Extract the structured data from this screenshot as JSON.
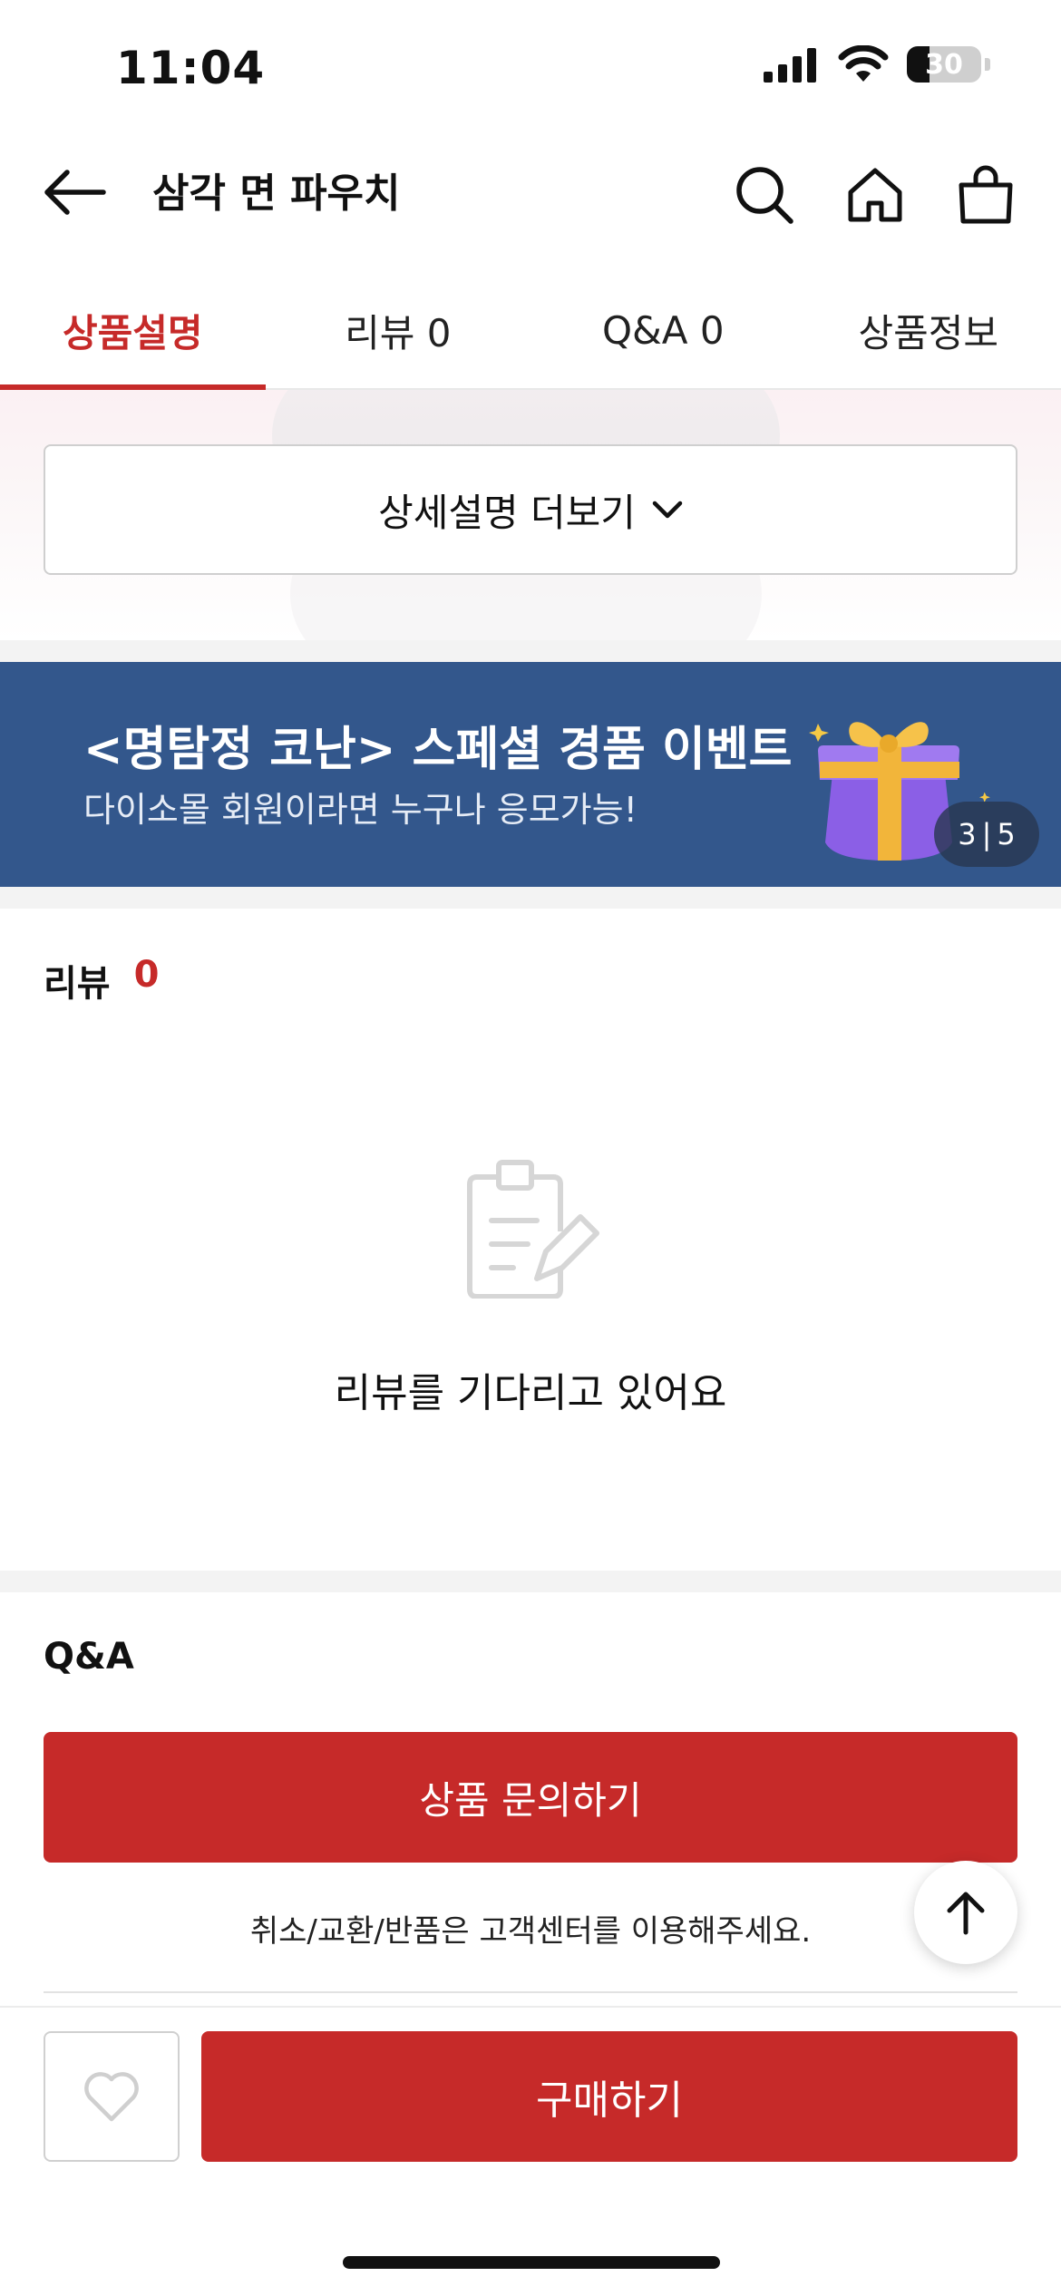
{
  "status_bar": {
    "time": "11:04",
    "battery": "30",
    "battery_level_fraction": 0.3,
    "icons": [
      "signal-icon",
      "wifi-icon",
      "battery-icon"
    ]
  },
  "header": {
    "title": "삼각 면 파우치",
    "icons": [
      "back-arrow-icon",
      "search-icon",
      "home-icon",
      "shopping-bag-icon"
    ]
  },
  "tabs": [
    {
      "label": "상품설명",
      "active": true
    },
    {
      "label": "리뷰 0",
      "active": false
    },
    {
      "label": "Q&A 0",
      "active": false
    },
    {
      "label": "상품정보",
      "active": false
    }
  ],
  "detail": {
    "more_label": "상세설명 더보기"
  },
  "banner": {
    "title": "<명탐정 코난> 스페셜 경품 이벤트",
    "subtitle": "다이소몰 회원이라면 누구나 응모가능!",
    "current": "3",
    "separator": "|",
    "total": "5",
    "background_color": "#33578c"
  },
  "reviews": {
    "heading": "리뷰",
    "count": "0",
    "empty_text": "리뷰를 기다리고 있어요"
  },
  "qna": {
    "heading": "Q&A",
    "inquiry_label": "상품 문의하기",
    "note": "취소/교환/반품은 고객센터를 이용해주세요."
  },
  "bottom_bar": {
    "buy_label": "구매하기"
  },
  "colors": {
    "accent": "#c62a29",
    "banner": "#33578c"
  }
}
